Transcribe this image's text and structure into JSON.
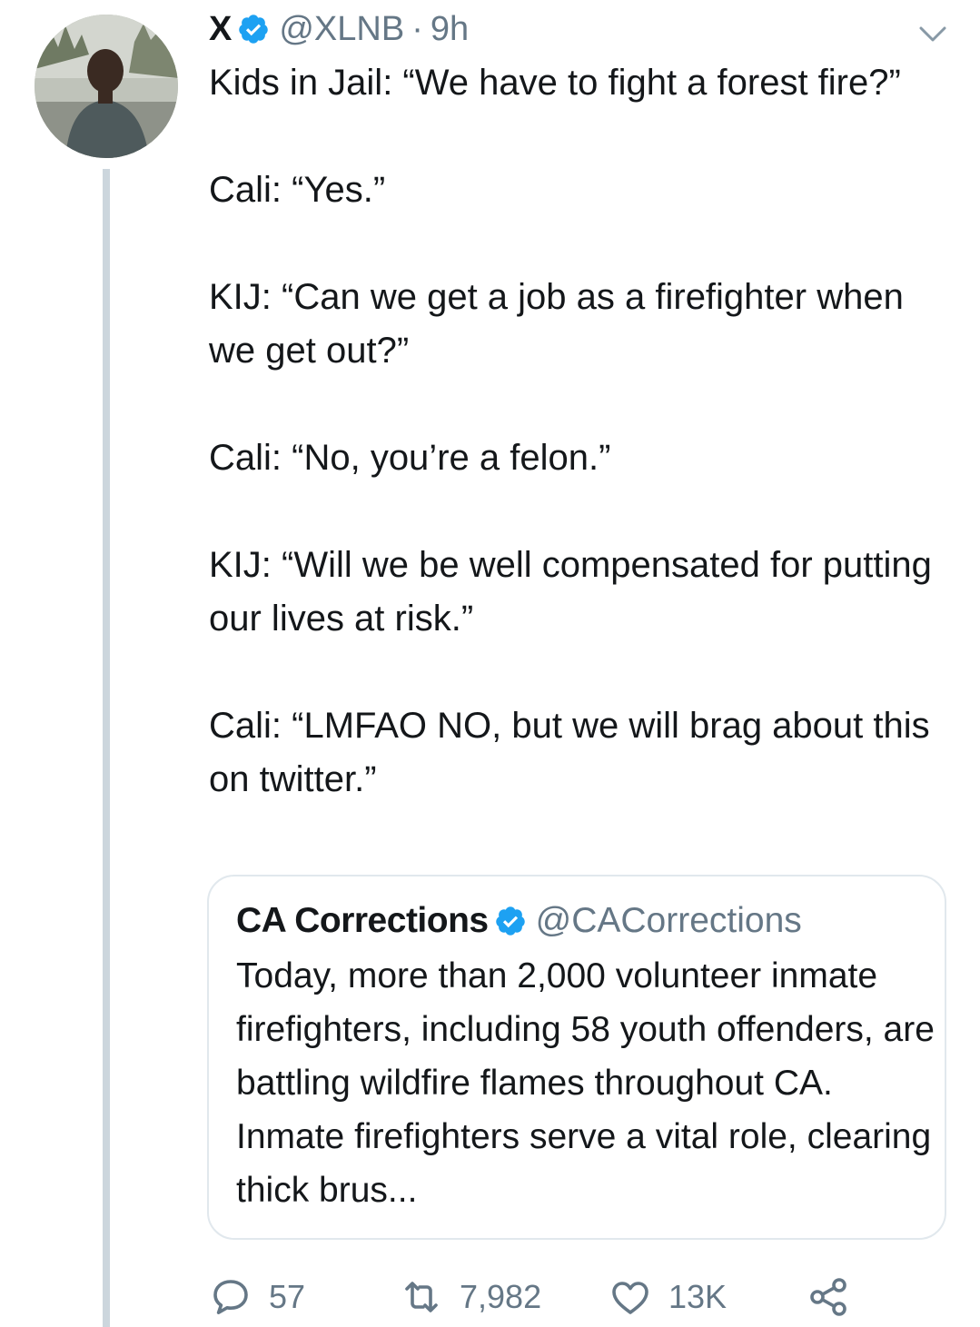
{
  "author": {
    "display_name": "X",
    "handle": "@XLNB",
    "separator": "·",
    "time": "9h"
  },
  "tweet": {
    "paragraphs": [
      "Kids in Jail: “We have to fight a forest fire?”",
      "Cali: “Yes.”",
      "KIJ: “Can we get a job as a firefighter when we get out?”",
      "Cali: “No, you’re a felon.”",
      "KIJ: “Will we be well compensated for putting our lives at risk.”",
      "Cali: “LMFAO NO, but we will brag about this on twitter.”"
    ]
  },
  "quoted_tweet": {
    "display_name": "CA Corrections",
    "handle": "@CACorrections",
    "text": "Today, more than 2,000 volunteer inmate firefighters, including 58 youth offenders, are battling wildfire flames throughout CA. Inmate firefighters serve a vital role, clearing thick brus..."
  },
  "actions": {
    "replies": "57",
    "retweets": "7,982",
    "likes": "13K"
  },
  "icons": {
    "verified": "verified-badge-icon",
    "caret": "chevron-down-icon",
    "reply": "reply-icon",
    "retweet": "retweet-icon",
    "like": "heart-icon",
    "share": "share-icon"
  },
  "colors": {
    "verified_blue": "#1da1f2",
    "muted_text": "#657786",
    "thread_line": "#ccd6dd",
    "border": "#e1e8ed"
  }
}
